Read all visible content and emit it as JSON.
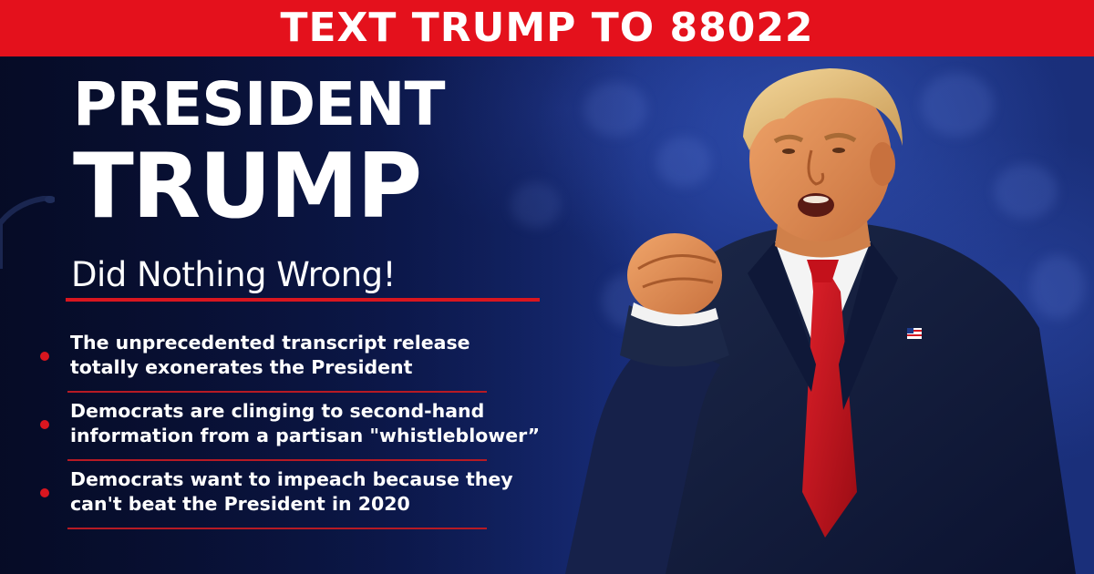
{
  "banner": {
    "text": "TEXT TRUMP TO 88022",
    "color": "#e4111c"
  },
  "headline": {
    "line1": "PRESIDENT",
    "line2": "TRUMP",
    "subhead": "Did Nothing Wrong!"
  },
  "bullets": [
    {
      "line1": "The unprecedented transcript release",
      "line2": "totally exonerates the President"
    },
    {
      "line1": "Democrats are clinging to second-hand",
      "line2": "information from a partisan \"whistleblower”"
    },
    {
      "line1": "Democrats want to impeach because they",
      "line2": "can't beat the President in 2020"
    }
  ],
  "colors": {
    "accent_red": "#d9161f",
    "background_blue": "#0f1f5e",
    "text": "#ffffff"
  },
  "image": {
    "subject": "speaker-photo"
  }
}
